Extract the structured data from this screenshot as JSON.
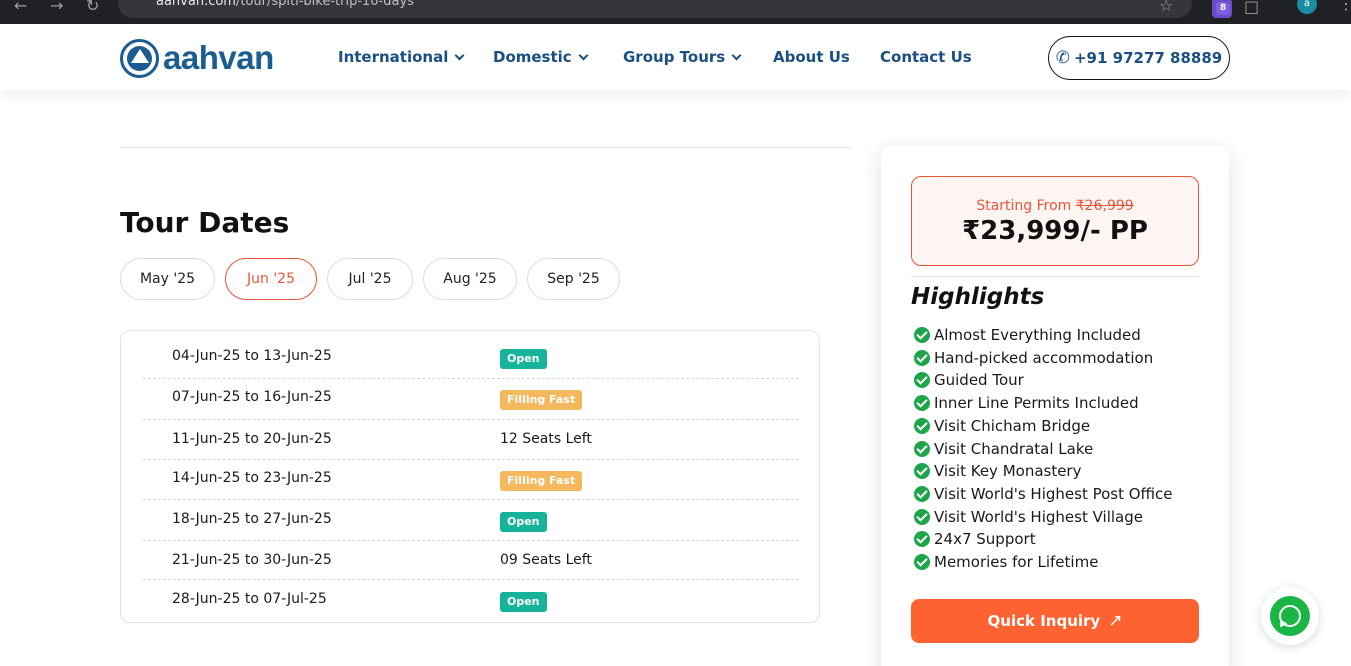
{
  "browser": {
    "url_host": "aahvan.com",
    "url_path": "/tour/spiti-bike-trip-10-days",
    "extension_badge": "8",
    "profile_initial": "a"
  },
  "header": {
    "logo_text": "aahvan",
    "nav": [
      {
        "label": "International",
        "has_dropdown": true
      },
      {
        "label": "Domestic",
        "has_dropdown": true
      },
      {
        "label": "Group Tours",
        "has_dropdown": true
      },
      {
        "label": "About Us",
        "has_dropdown": false
      },
      {
        "label": "Contact Us",
        "has_dropdown": false
      }
    ],
    "phone": "+91 97277 88889"
  },
  "tour_dates": {
    "title": "Tour Dates",
    "months": [
      "May '25",
      "Jun '25",
      "Jul '25",
      "Aug '25",
      "Sep '25"
    ],
    "selected_month": "Jun '25",
    "rows": [
      {
        "range": "04-Jun-25 to 13-Jun-25",
        "status": "Open",
        "status_type": "badge-open"
      },
      {
        "range": "07-Jun-25 to 16-Jun-25",
        "status": "Filling Fast",
        "status_type": "badge-fill"
      },
      {
        "range": "11-Jun-25 to 20-Jun-25",
        "status": "12 Seats Left",
        "status_type": "text"
      },
      {
        "range": "14-Jun-25 to 23-Jun-25",
        "status": "Filling Fast",
        "status_type": "badge-fill"
      },
      {
        "range": "18-Jun-25 to 27-Jun-25",
        "status": "Open",
        "status_type": "badge-open"
      },
      {
        "range": "21-Jun-25 to 30-Jun-25",
        "status": "09 Seats Left",
        "status_type": "text"
      },
      {
        "range": "28-Jun-25 to 07-Jul-25",
        "status": "Open",
        "status_type": "badge-open"
      }
    ]
  },
  "pricing": {
    "starting_label": "Starting From",
    "original_price": "₹26,999",
    "price": "₹23,999/- PP",
    "highlights_title": "Highlights",
    "highlights": [
      "Almost Everything Included",
      "Hand-picked accommodation",
      "Guided Tour",
      "Inner Line Permits Included",
      "Visit Chicham Bridge",
      "Visit Chandratal Lake",
      "Visit Key Monastery",
      "Visit World's Highest Post Office",
      "Visit World's Highest Village",
      "24x7 Support",
      "Memories for Lifetime"
    ],
    "cta_label": "Quick Inquiry"
  },
  "colors": {
    "brand_blue": "#1b5c92",
    "accent_orange": "#fe6230",
    "open_green": "#17b39a",
    "filling_amber": "#f5b85c",
    "check_green": "#1ea54a",
    "whatsapp_green": "#19b545"
  }
}
